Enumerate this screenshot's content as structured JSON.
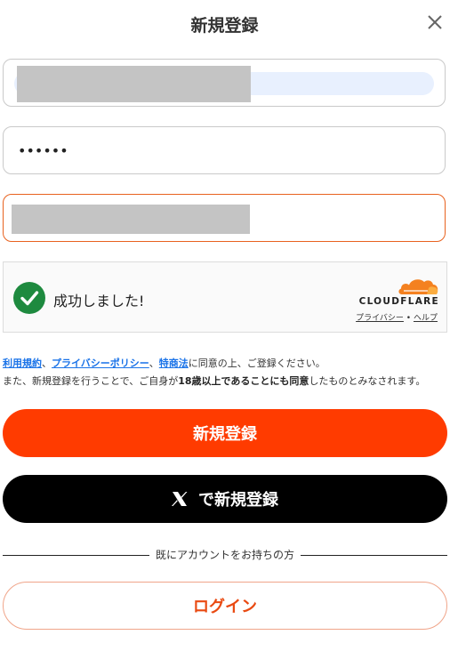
{
  "header": {
    "title": "新規登録"
  },
  "cloudflare": {
    "success_text": "成功しました!",
    "brand": "CLOUDFLARE",
    "privacy_link": "プライバシー",
    "separator": "•",
    "help_link": "ヘルプ"
  },
  "terms": {
    "link_terms": "利用規約",
    "sep1": "、",
    "link_privacy": "プライバシーポリシー",
    "sep2": "、",
    "link_law": "特商法",
    "line1_rest": "に同意の上、ご登録ください。",
    "line2_a": "また、新規登録を行うことで、ご自身が",
    "line2_bold": "18歳以上であることにも同意",
    "line2_b": "したものとみなされます。"
  },
  "fields": {
    "email_value": "",
    "password_value": "••••••",
    "nickname_value": ""
  },
  "buttons": {
    "register": "新規登録",
    "x_register": "で新規登録",
    "login": "ログイン"
  },
  "divider": {
    "text": "既にアカウントをお持ちの方"
  },
  "colors": {
    "primary": "#ff3b00",
    "cloudflare_orange": "#f48120",
    "success_green": "#1e8a3f",
    "link_blue": "#1a73e8"
  }
}
